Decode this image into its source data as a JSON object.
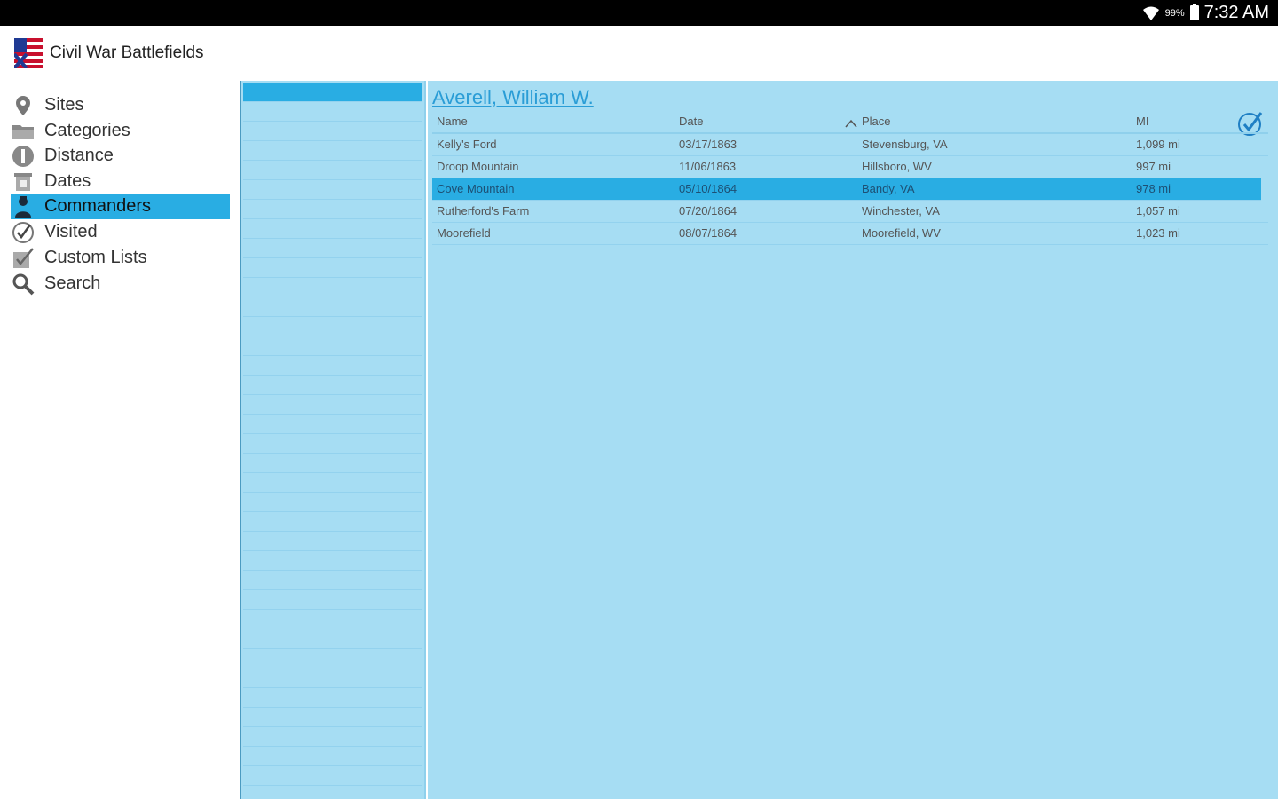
{
  "status_bar": {
    "battery": "99%",
    "time": "7:32 AM"
  },
  "app": {
    "title": "Civil War Battlefields"
  },
  "sidebar": {
    "items": [
      {
        "label": "Sites",
        "icon": "map-pin-icon"
      },
      {
        "label": "Categories",
        "icon": "folder-icon"
      },
      {
        "label": "Distance",
        "icon": "distance-icon"
      },
      {
        "label": "Dates",
        "icon": "calendar-icon"
      },
      {
        "label": "Commanders",
        "icon": "commander-icon",
        "active": true
      },
      {
        "label": "Visited",
        "icon": "check-circle-icon"
      },
      {
        "label": "Custom Lists",
        "icon": "custom-list-icon"
      },
      {
        "label": "Search",
        "icon": "search-icon"
      }
    ]
  },
  "detail": {
    "commander": "Averell, William W.",
    "columns": {
      "name": "Name",
      "date": "Date",
      "place": "Place",
      "mi": "MI"
    },
    "rows": [
      {
        "name": "Kelly's Ford",
        "date": "03/17/1863",
        "place": "Stevensburg, VA",
        "mi": "1,099 mi"
      },
      {
        "name": "Droop Mountain",
        "date": "11/06/1863",
        "place": "Hillsboro, WV",
        "mi": "997 mi"
      },
      {
        "name": "Cove Mountain",
        "date": "05/10/1864",
        "place": "Bandy, VA",
        "mi": "978 mi",
        "selected": true
      },
      {
        "name": "Rutherford's Farm",
        "date": "07/20/1864",
        "place": "Winchester, VA",
        "mi": "1,057 mi"
      },
      {
        "name": "Moorefield",
        "date": "08/07/1864",
        "place": "Moorefield, WV",
        "mi": "1,023 mi"
      }
    ]
  },
  "colors": {
    "accent": "#29ade3",
    "pane": "#a6ddf3",
    "link": "#2a9dd6"
  }
}
